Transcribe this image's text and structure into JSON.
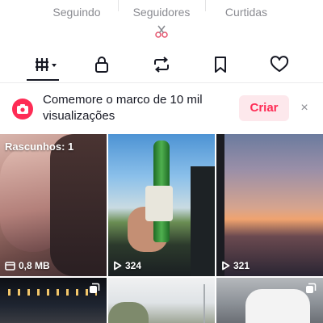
{
  "profile_stats": [
    {
      "label": "Seguindo"
    },
    {
      "label": "Seguidores"
    },
    {
      "label": "Curtidas"
    }
  ],
  "tabs": [
    {
      "name": "videos",
      "icon": "grid-icon"
    },
    {
      "name": "private",
      "icon": "lock-icon"
    },
    {
      "name": "reposts",
      "icon": "repost-icon"
    },
    {
      "name": "favorites",
      "icon": "bookmark-icon"
    },
    {
      "name": "liked",
      "icon": "heart-icon"
    }
  ],
  "banner": {
    "text": "Comemore o marco de 10 mil visualizações",
    "action_label": "Criar",
    "close_label": "×",
    "accent_color": "#fe2c55"
  },
  "grid": {
    "items": [
      {
        "drafts_label": "Rascunhos: 1",
        "stat_label": "0,8 MB",
        "stat_icon": "storage-icon"
      },
      {
        "stat_label": "324",
        "stat_icon": "play-icon"
      },
      {
        "stat_label": "321",
        "stat_icon": "play-icon"
      },
      {
        "badge_icon": "multi-photo-icon"
      },
      {},
      {
        "badge_icon": "multi-photo-icon"
      }
    ]
  },
  "colors": {
    "text_primary": "#161823",
    "text_secondary": "#8a8b91",
    "accent": "#fe2c55",
    "accent_light": "#fde8ec"
  }
}
